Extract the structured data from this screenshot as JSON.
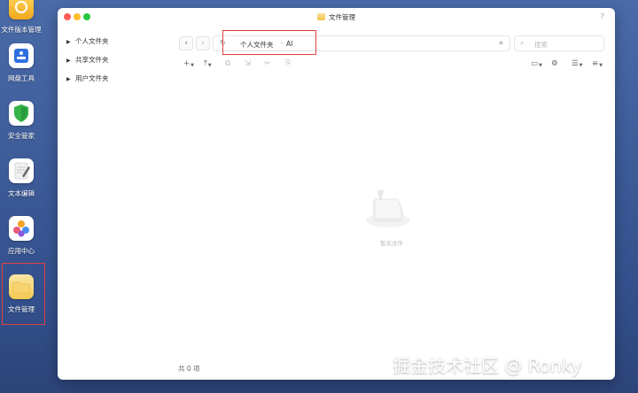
{
  "dock": {
    "apps": [
      {
        "label": "文件版本管理",
        "icon": "version-icon"
      },
      {
        "label": "网盘工具",
        "icon": "disk-icon"
      },
      {
        "label": "安全管家",
        "icon": "shield-icon"
      },
      {
        "label": "文本编辑",
        "icon": "text-edit-icon"
      },
      {
        "label": "应用中心",
        "icon": "app-center-icon"
      },
      {
        "label": "文件管理",
        "icon": "folder-icon"
      }
    ]
  },
  "window": {
    "title": "文件管理",
    "help": "?"
  },
  "sidebar": {
    "items": [
      {
        "label": "个人文件夹"
      },
      {
        "label": "共享文件夹"
      },
      {
        "label": "用户文件夹"
      }
    ]
  },
  "navigation": {
    "back": "‹",
    "forward": "›",
    "breadcrumb": [
      "个人文件夹",
      "AI"
    ],
    "separator": "›"
  },
  "search": {
    "placeholder": "搜索"
  },
  "toolbar": {
    "new": "+",
    "upload": "⤒"
  },
  "empty_state": {
    "text": "暂无文件"
  },
  "footer": {
    "count": "共 0 项"
  },
  "watermark": "掘金技术社区 @ Ronky",
  "colors": {
    "close": "#ff5f57",
    "minimize": "#febc2e",
    "maximize": "#28c840",
    "highlight_outline": "#e04040"
  }
}
